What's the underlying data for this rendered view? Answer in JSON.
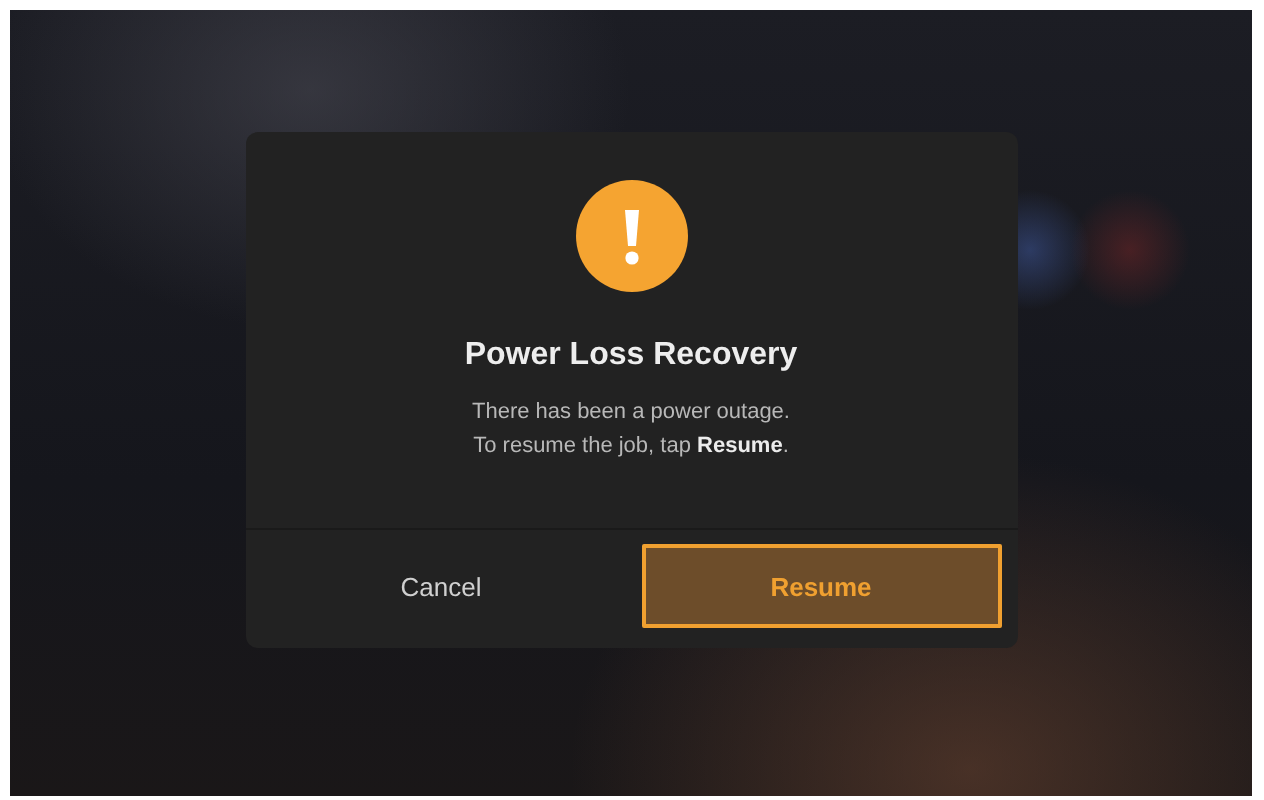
{
  "dialog": {
    "title": "Power Loss Recovery",
    "message": [
      "There has been a power outage.",
      "To resume the job, tap **Resume**."
    ],
    "buttons": [
      {
        "label": "Cancel",
        "kind": "secondary"
      },
      {
        "label": "Resume",
        "kind": "primary"
      }
    ]
  }
}
